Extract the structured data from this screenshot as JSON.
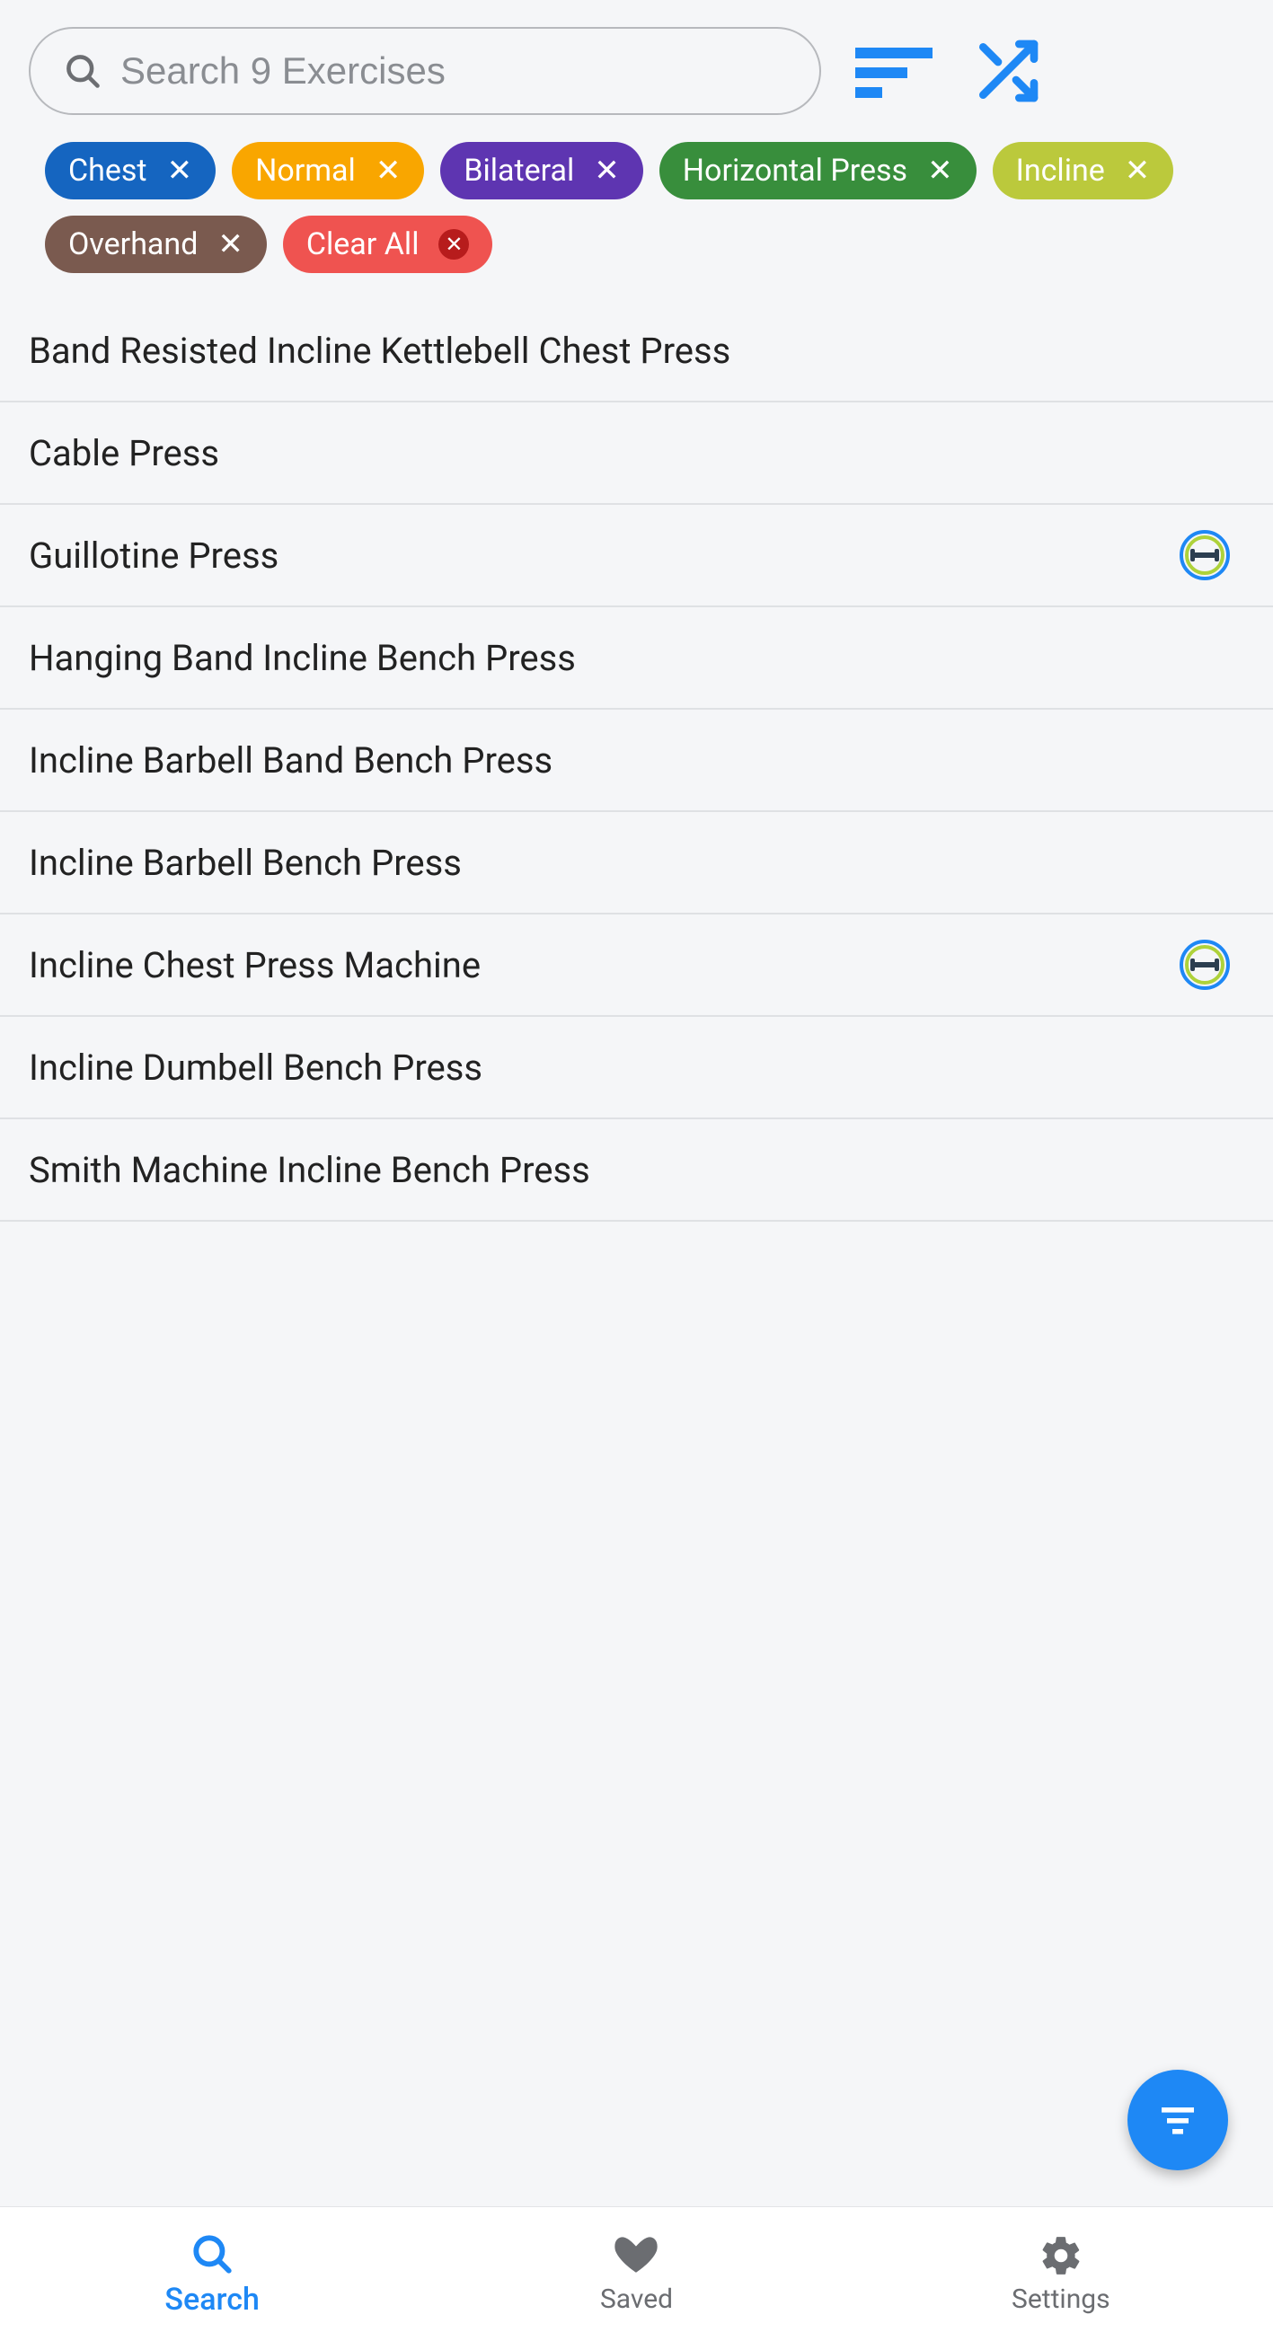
{
  "search": {
    "placeholder": "Search 9 Exercises",
    "value": ""
  },
  "filters": [
    {
      "label": "Chest",
      "color": "#1565C0"
    },
    {
      "label": "Normal",
      "color": "#F9A600"
    },
    {
      "label": "Bilateral",
      "color": "#5E35B1"
    },
    {
      "label": "Horizontal Press",
      "color": "#388E3C"
    },
    {
      "label": "Incline",
      "color": "#BBC93C"
    },
    {
      "label": "Overhand",
      "color": "#7A5A4F"
    }
  ],
  "clear_label": "Clear All",
  "exercises": [
    {
      "name": "Band Resisted Incline Kettlebell Chest Press",
      "has_badge": false
    },
    {
      "name": "Cable Press",
      "has_badge": false
    },
    {
      "name": "Guillotine Press",
      "has_badge": true
    },
    {
      "name": "Hanging Band Incline Bench Press",
      "has_badge": false
    },
    {
      "name": "Incline Barbell Band Bench Press",
      "has_badge": false
    },
    {
      "name": "Incline Barbell Bench Press",
      "has_badge": false
    },
    {
      "name": "Incline Chest Press Machine",
      "has_badge": true
    },
    {
      "name": "Incline Dumbell Bench Press",
      "has_badge": false
    },
    {
      "name": "Smith Machine Incline Bench Press",
      "has_badge": false
    }
  ],
  "nav": {
    "search": "Search",
    "saved": "Saved",
    "settings": "Settings"
  }
}
